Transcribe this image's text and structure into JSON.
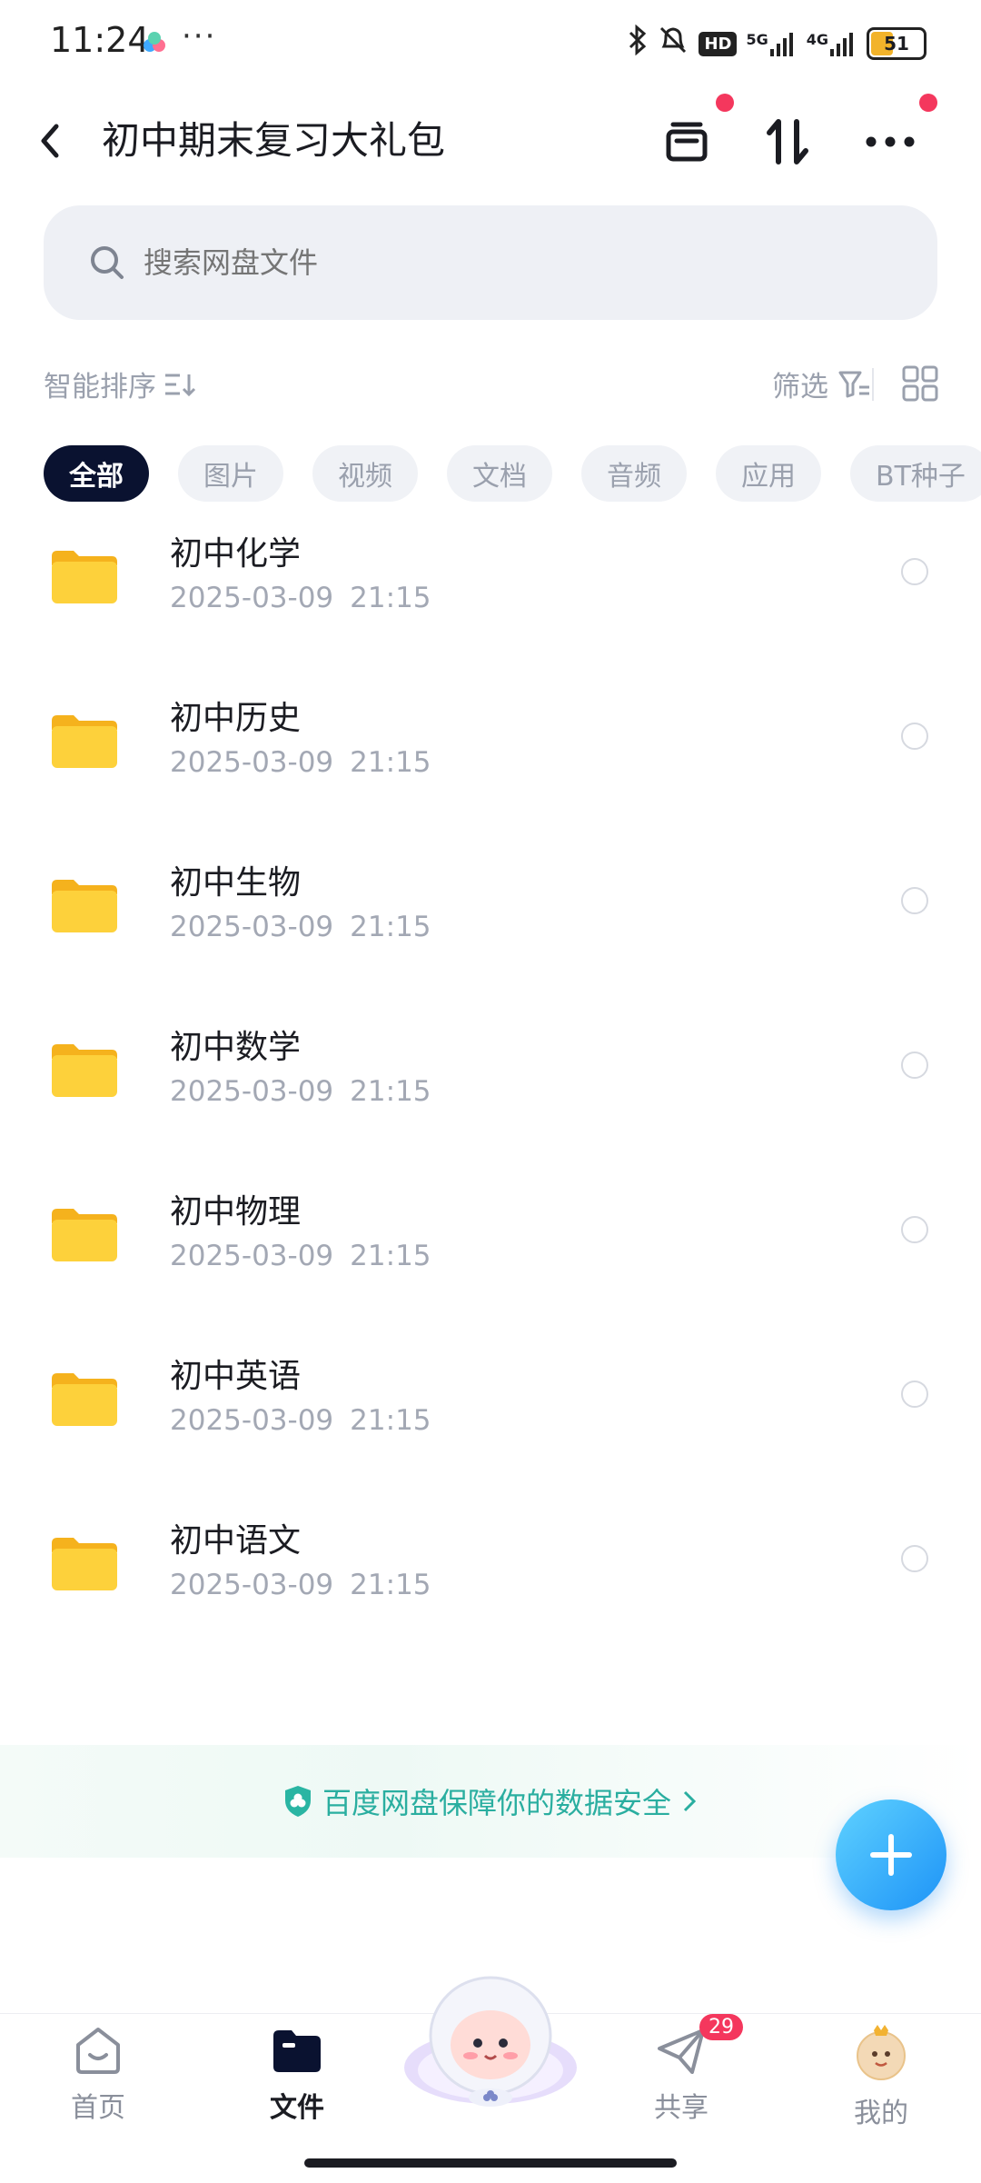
{
  "status_bar": {
    "time": "11:24",
    "dots": "···",
    "net_5g": "5G",
    "net_4g": "4G",
    "hd": "HD",
    "battery": "51"
  },
  "header": {
    "title": "初中期末复习大礼包"
  },
  "search": {
    "placeholder": "搜索网盘文件"
  },
  "toolbar": {
    "sort_label": "智能排序",
    "filter_label": "筛选"
  },
  "chips": [
    {
      "label": "全部",
      "active": true
    },
    {
      "label": "图片",
      "active": false
    },
    {
      "label": "视频",
      "active": false
    },
    {
      "label": "文档",
      "active": false
    },
    {
      "label": "音频",
      "active": false
    },
    {
      "label": "应用",
      "active": false
    },
    {
      "label": "BT种子",
      "active": false
    }
  ],
  "files": [
    {
      "name": "初中化学",
      "date": "2025-03-09",
      "time": "21:15"
    },
    {
      "name": "初中历史",
      "date": "2025-03-09",
      "time": "21:15"
    },
    {
      "name": "初中生物",
      "date": "2025-03-09",
      "time": "21:15"
    },
    {
      "name": "初中数学",
      "date": "2025-03-09",
      "time": "21:15"
    },
    {
      "name": "初中物理",
      "date": "2025-03-09",
      "time": "21:15"
    },
    {
      "name": "初中英语",
      "date": "2025-03-09",
      "time": "21:15"
    },
    {
      "name": "初中语文",
      "date": "2025-03-09",
      "time": "21:15"
    }
  ],
  "banner": {
    "text": "百度网盘保障你的数据安全"
  },
  "bottom_nav": {
    "home": "首页",
    "files": "文件",
    "share": "共享",
    "share_badge": "29",
    "mine": "我的"
  },
  "colors": {
    "accent": "#1d93f7",
    "chip_active_bg": "#0a1230",
    "red_dot": "#f4375d",
    "folder": "#fbc72f",
    "banner_text": "#2aaea0"
  }
}
